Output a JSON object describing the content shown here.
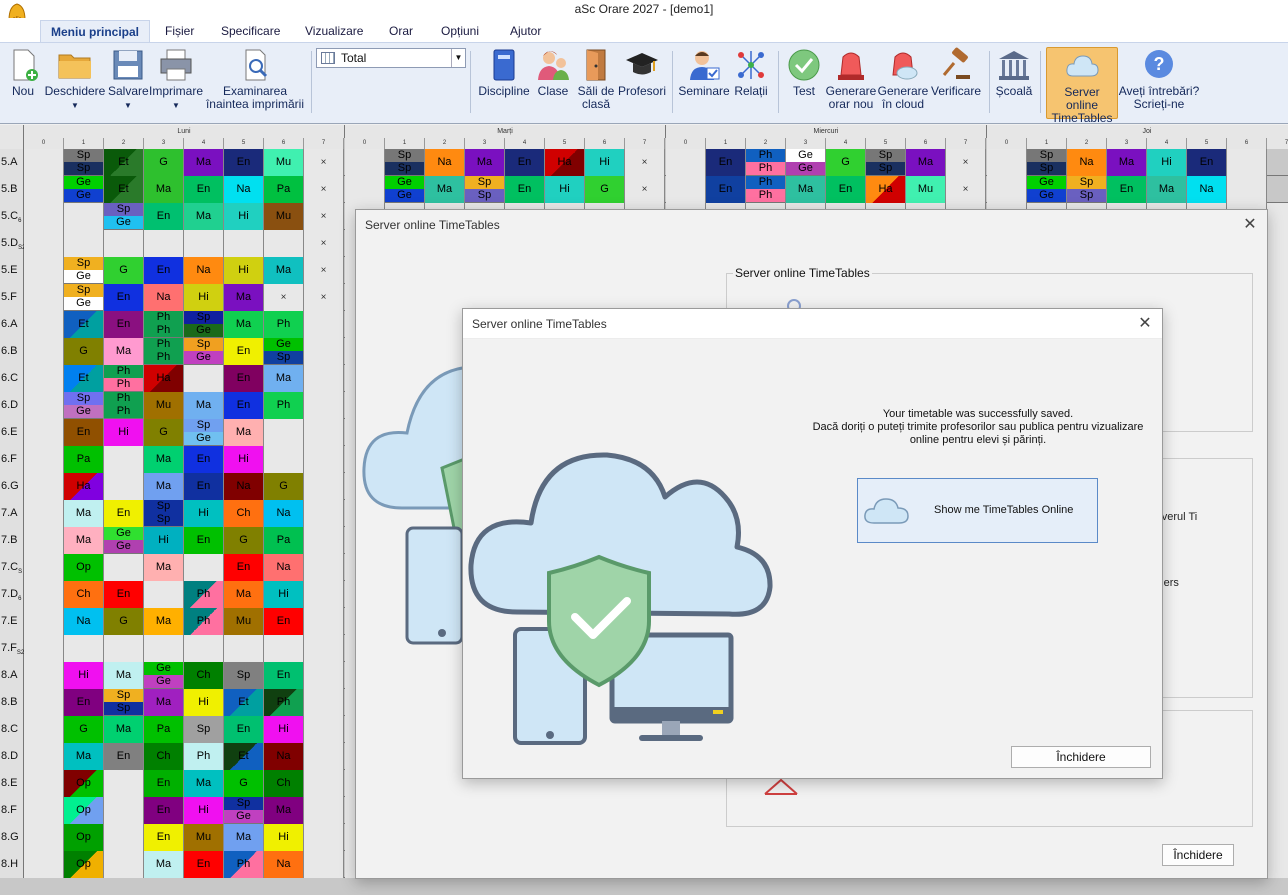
{
  "window": {
    "title": "aSc Orare 2027  - [demo1]"
  },
  "menu": [
    "Meniu principal",
    "Fișier",
    "Specificare",
    "Vizualizare",
    "Orar",
    "Opțiuni",
    "Ajutor"
  ],
  "ribbon": {
    "new": "Nou",
    "open": "Deschidere",
    "save": "Salvare",
    "print": "Imprimare",
    "preview": [
      "Examinarea",
      "înaintea imprimării"
    ],
    "view_combo": "Total",
    "subjects": "Discipline",
    "classes": "Clase",
    "rooms": [
      "Săli de",
      "clasă"
    ],
    "teachers": "Profesori",
    "seminars": "Seminare",
    "relations": "Relații",
    "test": "Test",
    "generate": [
      "Generare",
      "orar nou"
    ],
    "generate_cloud": [
      "Generare",
      "în cloud"
    ],
    "verify": "Verificare",
    "school": "Școală",
    "online_server": [
      "Server online",
      "TimeTables"
    ],
    "help": [
      "Aveți întrebări?",
      "Scrieți-ne"
    ]
  },
  "timetable": {
    "days": [
      "Luni",
      "Marți",
      "Miercuri",
      "Joi"
    ],
    "periods": [
      "0",
      "1",
      "2",
      "3",
      "4",
      "5",
      "6",
      "7"
    ],
    "rows": [
      {
        "label": "5.A",
        "cells": [
          [
            "",
            ""
          ],
          [
            "Sp|Sp",
            "#777|#1a3060"
          ],
          [
            "Et",
            "#0a5a0a/#2a7a2a"
          ],
          [
            "G",
            "#2ec02e"
          ],
          [
            "Ma",
            "#7a10c0"
          ],
          [
            "En",
            "#1a2a7a"
          ],
          [
            "Mu",
            "#40f0b0"
          ],
          [
            "×",
            ""
          ]
        ]
      },
      {
        "label": "5.B",
        "cells": [
          [
            "",
            ""
          ],
          [
            "Ge|Ge",
            "#00d000|#1040d0"
          ],
          [
            "Et",
            "#0a5a0a/#2a7a2a"
          ],
          [
            "Ma",
            "#2ec02e"
          ],
          [
            "En",
            "#00c060"
          ],
          [
            "Na",
            "#00e0f0"
          ],
          [
            "Pa",
            "#00c040"
          ],
          [
            "×",
            ""
          ]
        ]
      },
      {
        "label": "5.C",
        "sub": "6",
        "cells": [
          [
            "",
            ""
          ],
          [
            "",
            ""
          ],
          [
            "Sp|Ge",
            "#6a60c0|#20c0f0"
          ],
          [
            "En",
            "#00c070"
          ],
          [
            "Ma",
            "#20d090"
          ],
          [
            "Hi",
            "#20d0c0"
          ],
          [
            "Mu",
            "#8a5010"
          ],
          [
            "×",
            ""
          ]
        ]
      },
      {
        "label": "5.D",
        "sub": "S2",
        "cells": [
          [
            "",
            ""
          ],
          [
            "",
            ""
          ],
          [
            "",
            ""
          ],
          [
            "",
            ""
          ],
          [
            "",
            ""
          ],
          [
            "",
            ""
          ],
          [
            "",
            ""
          ],
          [
            "×",
            ""
          ]
        ]
      },
      {
        "label": "5.E",
        "cells": [
          [
            "",
            ""
          ],
          [
            "Sp|Ge",
            "#f0b020|#ffffff"
          ],
          [
            "G",
            "#30d030"
          ],
          [
            "En",
            "#1030e0"
          ],
          [
            "Na",
            "#ff8a10"
          ],
          [
            "Hi",
            "#d0d010"
          ],
          [
            "Ma",
            "#10c0c0"
          ],
          [
            "×",
            ""
          ]
        ]
      },
      {
        "label": "5.F",
        "cells": [
          [
            "",
            ""
          ],
          [
            "Sp|Ge",
            "#f0b020|#ffffff"
          ],
          [
            "En",
            "#1030e0"
          ],
          [
            "Na",
            "#ff7070"
          ],
          [
            "Hi",
            "#d0d010"
          ],
          [
            "Ma",
            "#7a10c0"
          ],
          [
            "×",
            ""
          ],
          [
            "×",
            ""
          ]
        ]
      },
      {
        "label": "6.A",
        "cells": [
          [
            "",
            ""
          ],
          [
            "Et",
            "#1060c0/#00a0a0"
          ],
          [
            "En",
            "#8a1080"
          ],
          [
            "Ph|Ph",
            "#10a050|#10a050"
          ],
          [
            "Sp|Ge",
            "#1020a0|#1a6a1a"
          ],
          [
            "Ma",
            "#10d050"
          ],
          [
            "Ph",
            "#10d050"
          ],
          [
            "",
            ""
          ]
        ]
      },
      {
        "label": "6.B",
        "cells": [
          [
            "",
            ""
          ],
          [
            "G",
            "#808000"
          ],
          [
            "Ma",
            "#ff9ad0"
          ],
          [
            "Ph|Ph",
            "#10a050|#10a050"
          ],
          [
            "Sp|Ge",
            "#f0a020|#c040c0"
          ],
          [
            "En",
            "#f0f000"
          ],
          [
            "Ge|Sp",
            "#00c000|#1040a0"
          ],
          [
            "",
            ""
          ]
        ]
      },
      {
        "label": "6.C",
        "cells": [
          [
            "",
            ""
          ],
          [
            "Et",
            "#0080f0/#00a0a0"
          ],
          [
            "Ph|Ph",
            "#10a050|#ff70a0"
          ],
          [
            "Ha",
            "#d00000/#800000"
          ],
          [
            "",
            ""
          ],
          [
            "En",
            "#800060"
          ],
          [
            "Ma",
            "#70b0f0"
          ],
          [
            "",
            ""
          ]
        ]
      },
      {
        "label": "6.D",
        "cells": [
          [
            "",
            ""
          ],
          [
            "Sp|Ge",
            "#7070f0|#c070c0"
          ],
          [
            "Ph|Ph",
            "#10a050|#10a050"
          ],
          [
            "Mu",
            "#a07000"
          ],
          [
            "Ma",
            "#70b0f0"
          ],
          [
            "En",
            "#1030e0"
          ],
          [
            "Ph",
            "#10d050"
          ],
          [
            "",
            ""
          ]
        ]
      },
      {
        "label": "6.E",
        "cells": [
          [
            "",
            ""
          ],
          [
            "En",
            "#905000"
          ],
          [
            "Hi",
            "#f010f0"
          ],
          [
            "G",
            "#808000"
          ],
          [
            "Sp|Ge",
            "#70a0f0|#70c0f0"
          ],
          [
            "Ma",
            "#ffb0b0"
          ],
          [
            "",
            ""
          ],
          [
            "",
            ""
          ]
        ]
      },
      {
        "label": "6.F",
        "cells": [
          [
            "",
            ""
          ],
          [
            "Pa",
            "#00c000"
          ],
          [
            "",
            ""
          ],
          [
            "Ma",
            "#00d070"
          ],
          [
            "En",
            "#1030e0"
          ],
          [
            "Hi",
            "#f010f0"
          ],
          [
            "",
            ""
          ],
          [
            "",
            ""
          ]
        ]
      },
      {
        "label": "6.G",
        "cells": [
          [
            "",
            ""
          ],
          [
            "Ha",
            "#d00000/#8000e0"
          ],
          [
            "",
            ""
          ],
          [
            "Ma",
            "#70a0f0"
          ],
          [
            "En",
            "#1030a0"
          ],
          [
            "Na",
            "#800000"
          ],
          [
            "G",
            "#808000"
          ],
          [
            "",
            ""
          ]
        ]
      },
      {
        "label": "7.A",
        "cells": [
          [
            "",
            ""
          ],
          [
            "Ma",
            "#c0f0f0"
          ],
          [
            "En",
            "#f0f000"
          ],
          [
            "Sp|Sp",
            "#1030a0|#1030a0"
          ],
          [
            "Hi",
            "#00c0c0"
          ],
          [
            "Ch",
            "#ff7010"
          ],
          [
            "Na",
            "#00c0f0"
          ],
          [
            "",
            ""
          ]
        ]
      },
      {
        "label": "7.B",
        "cells": [
          [
            "",
            ""
          ],
          [
            "Ma",
            "#ffb0c0"
          ],
          [
            "Ge|Ge",
            "#30e030|#b040b0"
          ],
          [
            "Hi",
            "#00b0c0"
          ],
          [
            "En",
            "#00c000"
          ],
          [
            "G",
            "#808000"
          ],
          [
            "Pa",
            "#00c050"
          ],
          [
            "",
            ""
          ]
        ]
      },
      {
        "label": "7.C",
        "sub": "S",
        "cells": [
          [
            "",
            ""
          ],
          [
            "Op",
            "#00c000"
          ],
          [
            "",
            ""
          ],
          [
            "Ma",
            "#ffb0b0"
          ],
          [
            "",
            ""
          ],
          [
            "En",
            "#ff0000"
          ],
          [
            "Na",
            "#ff7070"
          ],
          [
            "",
            ""
          ]
        ]
      },
      {
        "label": "7.D",
        "sub": "6",
        "cells": [
          [
            "",
            ""
          ],
          [
            "Ch",
            "#ff7010"
          ],
          [
            "En",
            "#ff0000"
          ],
          [
            "",
            ""
          ],
          [
            "Ph",
            "#008080/#ff70a0"
          ],
          [
            "Ma",
            "#ff7010"
          ],
          [
            "Hi",
            "#00c0c0"
          ],
          [
            "",
            ""
          ]
        ]
      },
      {
        "label": "7.E",
        "cells": [
          [
            "",
            ""
          ],
          [
            "Na",
            "#00c0f0"
          ],
          [
            "G",
            "#808000"
          ],
          [
            "Ma",
            "#ffb000"
          ],
          [
            "Ph",
            "#008080/#ff70a0"
          ],
          [
            "Mu",
            "#a07000"
          ],
          [
            "En",
            "#ff0000"
          ],
          [
            "",
            ""
          ]
        ]
      },
      {
        "label": "7.F",
        "sub": "S2",
        "cells": [
          [
            "",
            ""
          ],
          [
            "",
            ""
          ],
          [
            "",
            ""
          ],
          [
            "",
            ""
          ],
          [
            "",
            ""
          ],
          [
            "",
            ""
          ],
          [
            "",
            ""
          ],
          [
            "",
            ""
          ]
        ]
      },
      {
        "label": "8.A",
        "cells": [
          [
            "",
            ""
          ],
          [
            "Hi",
            "#f010f0"
          ],
          [
            "Ma",
            "#c0f0f0"
          ],
          [
            "Ge|Ge",
            "#00c000|#c040c0"
          ],
          [
            "Ch",
            "#008000"
          ],
          [
            "Sp",
            "#808080"
          ],
          [
            "En",
            "#00c070"
          ],
          [
            "",
            ""
          ]
        ]
      },
      {
        "label": "8.B",
        "cells": [
          [
            "",
            ""
          ],
          [
            "En",
            "#800080"
          ],
          [
            "Sp|Sp",
            "#f0b020|#1030a0"
          ],
          [
            "Ma",
            "#a020c0"
          ],
          [
            "Hi",
            "#f0f000"
          ],
          [
            "Et",
            "#1060c0/#00a0a0"
          ],
          [
            "Ph",
            "#104010/#10a050"
          ],
          [
            "",
            ""
          ]
        ]
      },
      {
        "label": "8.C",
        "cells": [
          [
            "",
            ""
          ],
          [
            "G",
            "#00c000"
          ],
          [
            "Ma",
            "#00d070"
          ],
          [
            "Pa",
            "#00c000"
          ],
          [
            "Sp",
            "#a0a0a0"
          ],
          [
            "En",
            "#00c070"
          ],
          [
            "Hi",
            "#f010f0"
          ],
          [
            "",
            ""
          ]
        ]
      },
      {
        "label": "8.D",
        "cells": [
          [
            "",
            ""
          ],
          [
            "Ma",
            "#00c0c0"
          ],
          [
            "En",
            "#808080"
          ],
          [
            "Ch",
            "#008000"
          ],
          [
            "Ph",
            "#c0f0f0"
          ],
          [
            "Et",
            "#104010/#1060c0"
          ],
          [
            "Na",
            "#800000"
          ],
          [
            "",
            ""
          ]
        ]
      },
      {
        "label": "8.E",
        "cells": [
          [
            "",
            ""
          ],
          [
            "Op",
            "#800000/#00c000"
          ],
          [
            "",
            ""
          ],
          [
            "En",
            "#00b000"
          ],
          [
            "Ma",
            "#00c0c0"
          ],
          [
            "G",
            "#00c000"
          ],
          [
            "Ch",
            "#008000"
          ],
          [
            "",
            ""
          ]
        ]
      },
      {
        "label": "8.F",
        "cells": [
          [
            "",
            ""
          ],
          [
            "Op",
            "#00f090/#70a0f0"
          ],
          [
            "",
            ""
          ],
          [
            "En",
            "#800080"
          ],
          [
            "Hi",
            "#f010f0"
          ],
          [
            "Sp|Ge",
            "#1030a0|#c040c0"
          ],
          [
            "Ma",
            "#800080"
          ],
          [
            "",
            ""
          ]
        ]
      },
      {
        "label": "8.G",
        "cells": [
          [
            "",
            ""
          ],
          [
            "Op",
            "#00a000"
          ],
          [
            "",
            ""
          ],
          [
            "En",
            "#f0f000"
          ],
          [
            "Mu",
            "#a07000"
          ],
          [
            "Ma",
            "#70a0f0"
          ],
          [
            "Hi",
            "#f0f000"
          ],
          [
            "",
            ""
          ]
        ]
      },
      {
        "label": "8.H",
        "cells": [
          [
            "",
            ""
          ],
          [
            "Op",
            "#008000/#f0b000"
          ],
          [
            "",
            ""
          ],
          [
            "Ma",
            "#c0f0f0"
          ],
          [
            "En",
            "#ff0000"
          ],
          [
            "Ph",
            "#1060c0/#ff70a0"
          ],
          [
            "Na",
            "#ff7010"
          ],
          [
            "",
            ""
          ]
        ]
      }
    ],
    "tue_cells": [
      [
        [
          "Sp|Sp",
          "#777|#1a3060"
        ],
        [
          "Na",
          "#ff8a10"
        ],
        [
          "Ma",
          "#7a10c0"
        ],
        [
          "En",
          "#1a2a7a"
        ],
        [
          "Ha",
          "#d00000/#800000"
        ],
        [
          "Hi",
          "#20d0c0"
        ],
        [
          "×",
          ""
        ]
      ],
      [
        [
          "Ge|Ge",
          "#00d000|#1040d0"
        ],
        [
          "Ma",
          "#2ec0a0"
        ],
        [
          "Sp|Sp",
          "#f0b020|#6a60c0"
        ],
        [
          "En",
          "#00c060"
        ],
        [
          "Hi",
          "#20d0c0"
        ],
        [
          "G",
          "#30d030"
        ],
        [
          "×",
          ""
        ]
      ]
    ],
    "wed_cells": [
      [
        [
          "En",
          "#1a2a7a"
        ],
        [
          "Ph|Ph",
          "#1060c0|#ff70a0"
        ],
        [
          "Ge|Ge",
          "#ffffff|#b040b0"
        ],
        [
          "G",
          "#30d030"
        ],
        [
          "Sp|Sp",
          "#777|#1a3060"
        ],
        [
          "Ma",
          "#7a10c0"
        ],
        [
          "×",
          ""
        ]
      ],
      [
        [
          "En",
          "#1040a0"
        ],
        [
          "Ph|Ph",
          "#1060c0|#ff70a0"
        ],
        [
          "Ma",
          "#2ec0a0"
        ],
        [
          "En",
          "#00c060"
        ],
        [
          "Ha",
          "#ff8a10/#d00000"
        ],
        [
          "Mu",
          "#40f0b0"
        ],
        [
          "×",
          ""
        ]
      ]
    ],
    "thu_cells": [
      [
        [
          "Sp|Sp",
          "#777|#1a3060"
        ],
        [
          "Na",
          "#ff8a10"
        ],
        [
          "Ma",
          "#7a10c0"
        ],
        [
          "Hi",
          "#20d0c0"
        ],
        [
          "En",
          "#1a2a7a"
        ],
        [
          "",
          ""
        ]
      ],
      [
        [
          "Ge|Ge",
          "#00d000|#1040d0"
        ],
        [
          "Sp|Sp",
          "#f0b020|#6a60c0"
        ],
        [
          "En",
          "#00c060"
        ],
        [
          "Ma",
          "#2ec0a0"
        ],
        [
          "Na",
          "#00e0f0"
        ],
        [
          "",
          ""
        ]
      ]
    ]
  },
  "dialog_back": {
    "title": "Server online TimeTables",
    "group_label": "Server online TimeTables",
    "fragment_1": "e pe serverul Ti",
    "fragment_2": "chers",
    "close_label": "Închidere"
  },
  "dialog_front": {
    "title": "Server online TimeTables",
    "message_line1": "Your timetable was successfully saved.",
    "message_line2": "Dacă doriți o puteți trimite profesorilor sau publica pentru vizualizare",
    "message_line3": "online pentru elevi și părinți.",
    "show_button": "Show me TimeTables Online",
    "close_label": "Închidere"
  },
  "colors": {
    "ribbon_bg": "#e8eef8",
    "highlight": "#f6c470",
    "cloud": "#cfe6f6",
    "shield": "#9fd4a8"
  }
}
